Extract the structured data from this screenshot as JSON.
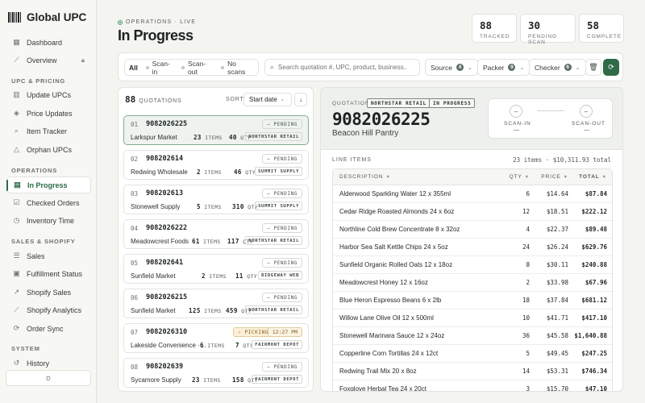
{
  "sidebar": {
    "brand": "Global UPC",
    "sections": [
      {
        "label": "UPC & PRICING"
      },
      {
        "label": "OPERATIONS"
      },
      {
        "label": "SALES & SHOPIFY"
      },
      {
        "label": "SYSTEM"
      }
    ],
    "items": [
      {
        "label": "Dashboard",
        "icon": "grid-icon"
      },
      {
        "label": "Overview",
        "icon": "chart-icon"
      },
      {
        "label": "Update UPCs",
        "icon": "barcode-icon"
      },
      {
        "label": "Price Updates",
        "icon": "tag-icon"
      },
      {
        "label": "Item Tracker",
        "icon": "search-icon"
      },
      {
        "label": "Orphan UPCs",
        "icon": "warning-icon"
      },
      {
        "label": "In Progress",
        "icon": "clipboard-icon"
      },
      {
        "label": "Checked Orders",
        "icon": "check-square-icon"
      },
      {
        "label": "Inventory Time",
        "icon": "clock-icon"
      },
      {
        "label": "Sales",
        "icon": "list-icon"
      },
      {
        "label": "Fulfillment Status",
        "icon": "box-icon"
      },
      {
        "label": "Shopify Sales",
        "icon": "trend-icon"
      },
      {
        "label": "Shopify Analytics",
        "icon": "analytics-icon"
      },
      {
        "label": "Order Sync",
        "icon": "sync-icon"
      },
      {
        "label": "History",
        "icon": "history-icon"
      }
    ]
  },
  "header": {
    "eyebrow": "OPERATIONS · LIVE",
    "title": "In Progress",
    "stats": [
      {
        "value": "88",
        "label": "TRACKED"
      },
      {
        "value": "30",
        "label": "PENDING SCAN"
      },
      {
        "value": "58",
        "label": "COMPLETE"
      }
    ]
  },
  "filters": {
    "segments": [
      "All",
      "Scan-in",
      "Scan-out",
      "No scans"
    ],
    "search_placeholder": "Search quotation #, UPC, product, business...",
    "source": {
      "label": "Source",
      "count": "4"
    },
    "packer": {
      "label": "Packer",
      "count": "9"
    },
    "checker": {
      "label": "Checker",
      "count": "6"
    }
  },
  "list": {
    "count": "88",
    "caption": "QUOTATIONS",
    "sort_label": "SORT",
    "sort_value": "Start date",
    "cards": [
      {
        "idx": "01",
        "id": "9082026225",
        "status": "— PENDING",
        "name": "Larkspur Market",
        "items": "23",
        "qty": "40",
        "packer": "NORTHSTAR RETAIL"
      },
      {
        "idx": "02",
        "id": "908202614",
        "status": "— PENDING",
        "name": "Redwing Wholesale",
        "items": "2",
        "qty": "46",
        "packer": "SUMMIT SUPPLY"
      },
      {
        "idx": "03",
        "id": "908202613",
        "status": "— PENDING",
        "name": "Stonewell Supply",
        "items": "5",
        "qty": "310",
        "packer": "SUMMIT SUPPLY"
      },
      {
        "idx": "04",
        "id": "9082026222",
        "status": "— PENDING",
        "name": "Meadowcrest Foods",
        "items": "61",
        "qty": "117",
        "packer": "NORTHSTAR RETAIL"
      },
      {
        "idx": "05",
        "id": "908202641",
        "status": "— PENDING",
        "name": "Sunfield Market",
        "items": "2",
        "qty": "11",
        "packer": "RIDGEWAY WEB"
      },
      {
        "idx": "06",
        "id": "9082026215",
        "status": "— PENDING",
        "name": "Sunfield Market",
        "items": "125",
        "qty": "459",
        "packer": "NORTHSTAR RETAIL"
      },
      {
        "idx": "07",
        "id": "9082026310",
        "status": "› PICKING",
        "time": "12:27 PM",
        "name": "Lakeside Convenience ·…",
        "items": "6",
        "qty": "7",
        "packer": "FAIRMONT DEPOT"
      },
      {
        "idx": "08",
        "id": "908202639",
        "status": "— PENDING",
        "name": "Sycamore Supply",
        "items": "23",
        "qty": "158",
        "packer": "FAIRMONT DEPOT"
      }
    ],
    "items_unit": "ITEMS",
    "qty_unit": "QTY"
  },
  "detail": {
    "label": "QUOTATION",
    "source_tag": "NORTHSTAR RETAIL",
    "status_tag": "IN PROGRESS",
    "number": "9082026225",
    "business": "Beacon Hill Pantry",
    "scan_in_label": "SCAN-IN",
    "scan_out_label": "SCAN-OUT",
    "scan_in_value": "—",
    "scan_out_value": "—",
    "line_items_title": "LINE ITEMS",
    "summary": "23 items · $10,311.93 total",
    "columns": [
      "DESCRIPTION",
      "QTY",
      "PRICE",
      "TOTAL"
    ],
    "rows": [
      {
        "desc": "Alderwood Sparkling Water 12 x 355ml",
        "qty": "6",
        "price": "$14.64",
        "total": "$87.84"
      },
      {
        "desc": "Cedar Ridge Roasted Almonds 24 x 6oz",
        "qty": "12",
        "price": "$18.51",
        "total": "$222.12"
      },
      {
        "desc": "Northline Cold Brew Concentrate 8 x 32oz",
        "qty": "4",
        "price": "$22.37",
        "total": "$89.48"
      },
      {
        "desc": "Harbor Sea Salt Kettle Chips 24 x 5oz",
        "qty": "24",
        "price": "$26.24",
        "total": "$629.76"
      },
      {
        "desc": "Sunfield Organic Rolled Oats 12 x 18oz",
        "qty": "8",
        "price": "$30.11",
        "total": "$240.88"
      },
      {
        "desc": "Meadowcrest Honey 12 x 16oz",
        "qty": "2",
        "price": "$33.98",
        "total": "$67.96"
      },
      {
        "desc": "Blue Heron Espresso Beans 6 x 2lb",
        "qty": "18",
        "price": "$37.84",
        "total": "$681.12"
      },
      {
        "desc": "Willow Lane Olive Oil 12 x 500ml",
        "qty": "10",
        "price": "$41.71",
        "total": "$417.10"
      },
      {
        "desc": "Stonewell Marinara Sauce 12 x 24oz",
        "qty": "36",
        "price": "$45.58",
        "total": "$1,640.88"
      },
      {
        "desc": "Copperline Corn Tortillas 24 x 12ct",
        "qty": "5",
        "price": "$49.45",
        "total": "$247.25"
      },
      {
        "desc": "Redwing Trail Mix 20 x 8oz",
        "qty": "14",
        "price": "$53.31",
        "total": "$746.34"
      },
      {
        "desc": "Foxglove Herbal Tea 24 x 20ct",
        "qty": "3",
        "price": "$15.70",
        "total": "$47.10"
      }
    ]
  },
  "colors": {
    "accent": "#2f6b47",
    "picking": "#fbf0d7"
  }
}
